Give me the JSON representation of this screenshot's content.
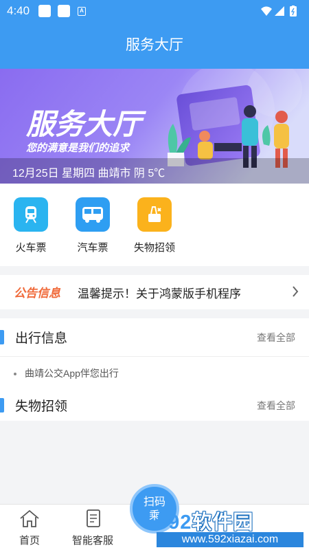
{
  "status_bar": {
    "time": "4:40",
    "a_icon": "A"
  },
  "header": {
    "title": "服务大厅"
  },
  "banner": {
    "headline": "服务大厅",
    "slogan": "您的满意是我们的追求",
    "info": "12月25日 星期四 曲靖市 阴 5℃"
  },
  "services": [
    {
      "label": "火车票",
      "icon": "train-icon",
      "color": "#2ab4f0"
    },
    {
      "label": "汽车票",
      "icon": "bus-icon",
      "color": "#2e9ef2"
    },
    {
      "label": "失物招领",
      "icon": "lost-found-icon",
      "color": "#fbb21c"
    }
  ],
  "notice": {
    "tag": "公告信息",
    "text": "温馨提示！关于鸿蒙版手机程序"
  },
  "travel": {
    "title": "出行信息",
    "more": "查看全部",
    "items": [
      "曲靖公交App伴您出行"
    ]
  },
  "lost_found": {
    "title": "失物招领",
    "more": "查看全部"
  },
  "tabbar": {
    "home": "首页",
    "service": "智能客服",
    "scan": "扫码乘车",
    "scan_line1": "扫码",
    "scan_line2": "乘"
  },
  "watermark": {
    "brand_num": "592",
    "brand_text": "软件园",
    "url": "www.592xiazai.com"
  },
  "colors": {
    "primary": "#3d9bf2",
    "notice_tag": "#f06a3a",
    "banner": "#7b5ee8"
  }
}
